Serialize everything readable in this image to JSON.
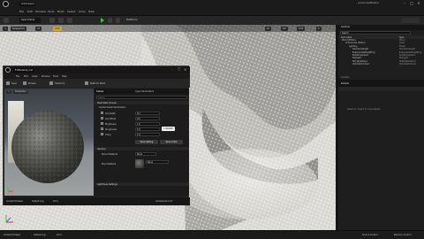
{
  "app": {
    "tab_title": "ActionLevel",
    "menu": [
      "File",
      "Edit",
      "Window",
      "Tools",
      "Build",
      "Select",
      "Actor",
      "Help"
    ],
    "project_name": "LandscapeMaterial",
    "select_mode": "Select Mode",
    "platforms": "Platforms"
  },
  "viewport": {
    "view_mode": "Perspective",
    "lighting": "Lit",
    "show": "Unlit",
    "grid": "10",
    "angle": "10°",
    "scale": "0.25",
    "camera": "4"
  },
  "outliner": {
    "title": "Outliner",
    "search_placeholder": "Search",
    "col_item": "Item Label",
    "col_type": "Type",
    "rows": [
      {
        "label": "World (Editor)",
        "type": "World"
      },
      {
        "label": "ActionLevel (Editor)",
        "type": "Level"
      },
      {
        "label": "Lighting",
        "type": "Folder"
      },
      {
        "label": "DirectionalLight",
        "type": "DirectionalLight"
      },
      {
        "label": "ExponentialHeightFog",
        "type": "ExponentialHeightFog"
      },
      {
        "label": "SkyAtmosphere",
        "type": "SkyAtmosphere"
      },
      {
        "label": "SkyLight",
        "type": "SkyLight"
      },
      {
        "label": "SM_SkySphere",
        "type": "StaticMeshActor"
      },
      {
        "label": "VolumetricCloud",
        "type": "VolumetricCloud"
      }
    ],
    "footer": "9 actors"
  },
  "details": {
    "title": "Details",
    "empty": "Select an object to view details."
  },
  "material_editor": {
    "tab": "ExtMaterial_Inst",
    "menu": [
      "File",
      "Edit",
      "Asset",
      "Window",
      "Tools",
      "Help"
    ],
    "toolbar": [
      "Save",
      "Browse",
      "Hierarchy",
      "Platform Stats"
    ],
    "preview_label": "Perspective",
    "details_tab": "Details",
    "params_tab": "Layer Parameters",
    "search_placeholder": "Search",
    "section_params": "Parameter Groups",
    "group": "Global Scalar Parameters",
    "params": [
      {
        "name": "AO_Depth",
        "value": "0.2"
      },
      {
        "name": "AO_Offset",
        "value": "0.0"
      },
      {
        "name": "Brightness",
        "value": "1.0"
      },
      {
        "name": "Roughness",
        "value": "1.0"
      },
      {
        "name": "Tiling",
        "value": "1.0"
      }
    ],
    "tooltip": "1.000000",
    "save_sibling": "Save Sibling",
    "save_child": "Save Child",
    "section_general": "General",
    "parent_label": "Parent Material",
    "parent_value": "None",
    "physical_label": "Phys Material",
    "phys_value": "None",
    "section_lightmass": "Lightmass Settings",
    "status": "Unresolved 4.17",
    "content_drawer": "Content Drawer",
    "output_log": "Output Log",
    "cmd": "Cmd"
  },
  "bottombar": {
    "content_drawer": "Content Drawer",
    "output_log": "Output Log",
    "cmd": "Cmd",
    "source_control": "Source Control",
    "revision": "Revision Control"
  }
}
